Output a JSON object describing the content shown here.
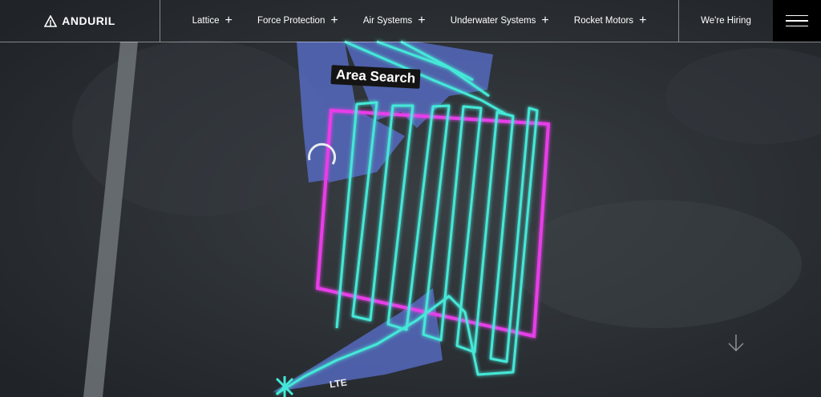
{
  "brand": {
    "name": "ANDURIL",
    "logo_icon": "anduril-logo-icon"
  },
  "nav": {
    "items": [
      {
        "label": "Lattice",
        "icon": "plus-icon"
      },
      {
        "label": "Force Protection",
        "icon": "plus-icon"
      },
      {
        "label": "Air Systems",
        "icon": "plus-icon"
      },
      {
        "label": "Underwater Systems",
        "icon": "plus-icon"
      },
      {
        "label": "Rocket Motors",
        "icon": "plus-icon"
      }
    ],
    "hiring_label": "We're Hiring",
    "menu_icon": "hamburger-menu-icon"
  },
  "hero": {
    "map_label": "Area Search",
    "signal_label": "LTE",
    "scroll_icon": "arrow-down-icon",
    "colors": {
      "path": "#45e8d8",
      "boundary": "#e83ee8",
      "sensor": "#5b73d6"
    }
  }
}
